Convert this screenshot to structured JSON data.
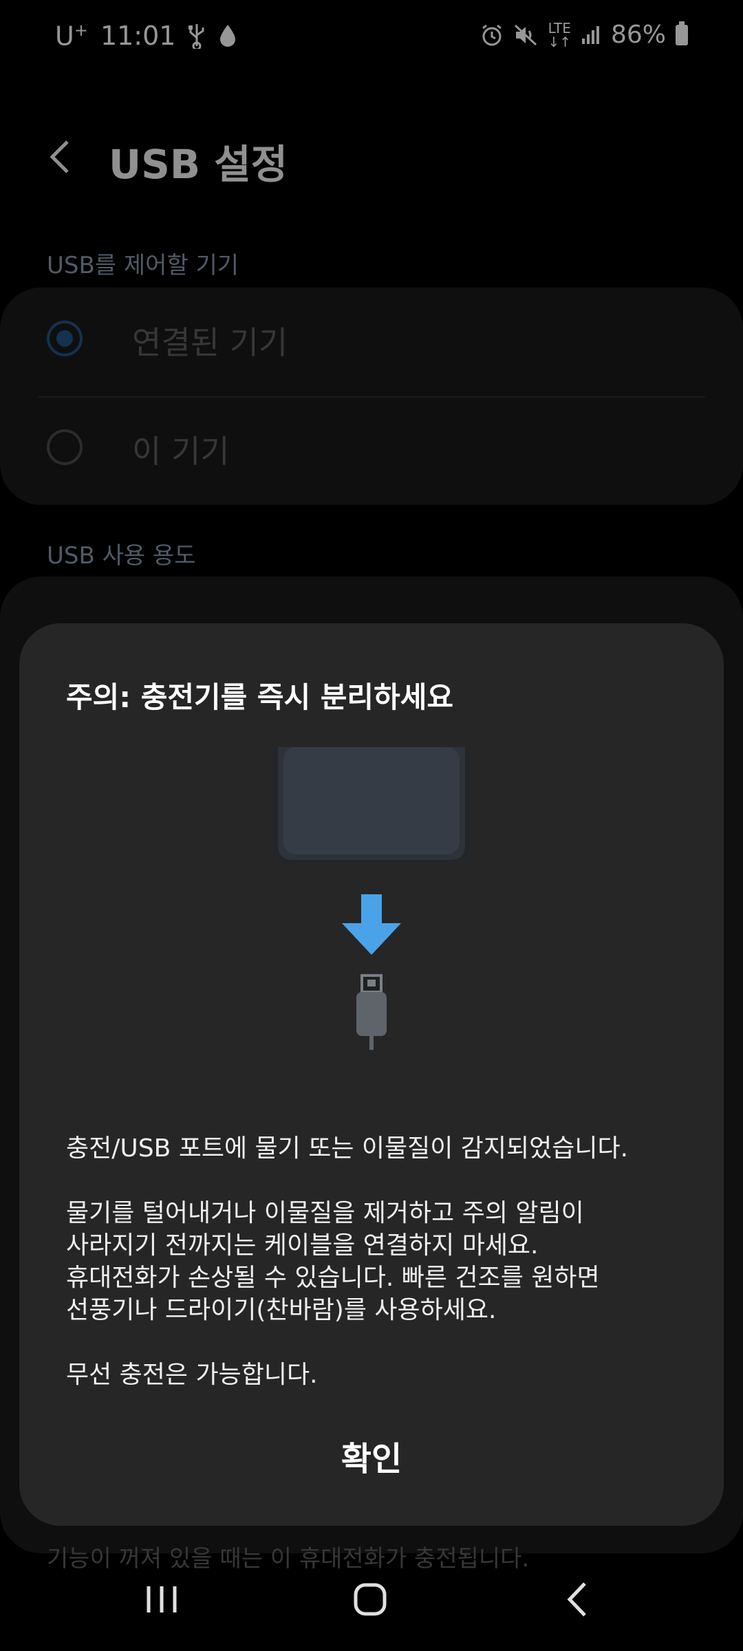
{
  "status_bar": {
    "carrier": "U",
    "carrier_sup": "+",
    "time": "11:01",
    "network": "LTE",
    "battery": "86%"
  },
  "header": {
    "title": "USB 설정"
  },
  "sections": {
    "control_label": "USB를 제어할 기기",
    "control_options": [
      "연결된 기기",
      "이 기기"
    ],
    "usage_label": "USB 사용 용도",
    "bottom_peek": "기능이 꺼져 있을 때는 이 휴대전화가 충전됩니다."
  },
  "dialog": {
    "title": "주의: 충전기를 즉시 분리하세요",
    "paragraphs": [
      "충전/USB 포트에 물기 또는 이물질이 감지되었습니다.",
      "물기를 털어내거나 이물질을 제거하고 주의 알림이\n사라지기 전까지는 케이블을 연결하지 마세요.\n휴대전화가 손상될 수 있습니다. 빠른 건조를 원하면\n선풍기나 드라이기(찬바람)를 사용하세요.",
      "무선 충전은 가능합니다."
    ],
    "confirm_label": "확인"
  },
  "colors": {
    "dialog_bg": "#262626",
    "arrow": "#4aa3e8",
    "radio_selected": "#1e4d7a"
  }
}
